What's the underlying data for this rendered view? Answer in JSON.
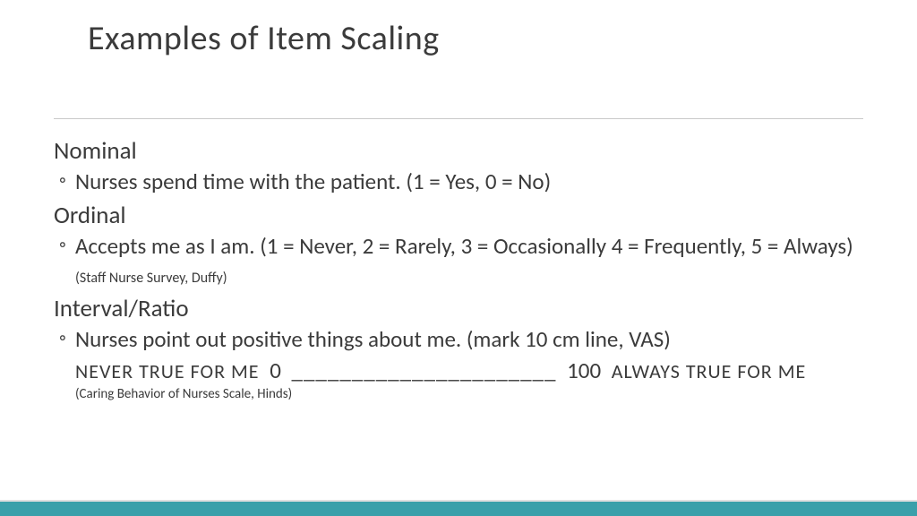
{
  "title": "Examples of Item Scaling",
  "sections": {
    "nominal": {
      "heading": "Nominal",
      "bullet": "Nurses spend time with the patient. (1 = Yes, 0 = No)"
    },
    "ordinal": {
      "heading": "Ordinal",
      "bullet_main": "Accepts me as I am. (1 = Never, 2 = Rarely, 3 = Occasionally 4 = Frequently, 5 = Always) ",
      "bullet_cite": "(Staff Nurse Survey, Duffy)"
    },
    "interval": {
      "heading": "Interval/Ratio",
      "bullet": "Nurses point out positive things about me.     (mark 10 cm line, VAS)",
      "vas_left": "NEVER TRUE FOR ME",
      "vas_zero": "0",
      "vas_line": "______________________",
      "vas_hundred": "100",
      "vas_right": "ALWAYS TRUE FOR ME",
      "cite": "(Caring Behavior of Nurses Scale, Hinds)"
    }
  }
}
